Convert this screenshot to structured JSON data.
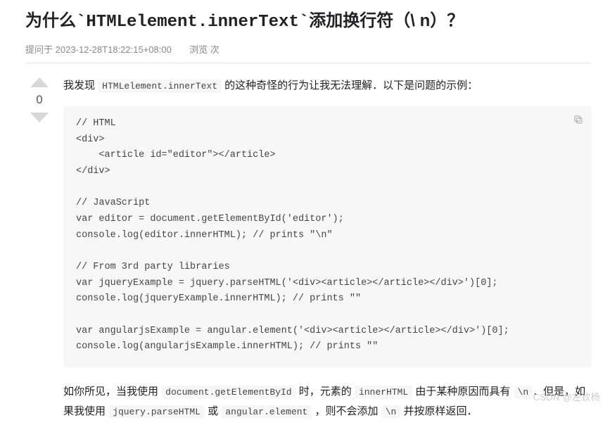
{
  "title": {
    "pre": "为什么",
    "code": "`HTMLelement.innerText`",
    "post": "添加换行符（\\ n）？"
  },
  "meta": {
    "asked_label": "提问于",
    "asked_time": "2023-12-28T18:22:15+08:00",
    "views_label": "浏览",
    "views_suffix": "次"
  },
  "vote": {
    "count": "0"
  },
  "intro": {
    "p1a": "我发现 ",
    "p1_code": "HTMLelement.innerText",
    "p1b": " 的这种奇怪的行为让我无法理解．以下是问题的示例："
  },
  "code": "// HTML\n<div>\n    <article id=\"editor\"></article>\n</div>\n\n// JavaScript\nvar editor = document.getElementById('editor');\nconsole.log(editor.innerHTML); // prints \"\\n\"\n\n// From 3rd party libraries\nvar jqueryExample = jquery.parseHTML('<div><article></article></div>')[0];\nconsole.log(jqueryExample.innerHTML); // prints \"\"\n\nvar angularjsExample = angular.element('<div><article></article></div>')[0];\nconsole.log(angularjsExample.innerHTML); // prints \"\"",
  "after": {
    "t1": "如你所见，当我使用 ",
    "c1": "document.getElementById",
    "t2": " 时，元素的 ",
    "c2": "innerHTML",
    "t3": " 由于某种原因而具有 ",
    "c3": "\\n",
    "t4": "．但是，如果我使用 ",
    "c4": "jquery.parseHTML",
    "t5": " 或 ",
    "c5": "angular.element",
    "t6": " ，则不会添加 ",
    "c6": "\\n",
    "t7": " 并按原样返回．"
  },
  "watermark": "CSDN @左钦杨"
}
